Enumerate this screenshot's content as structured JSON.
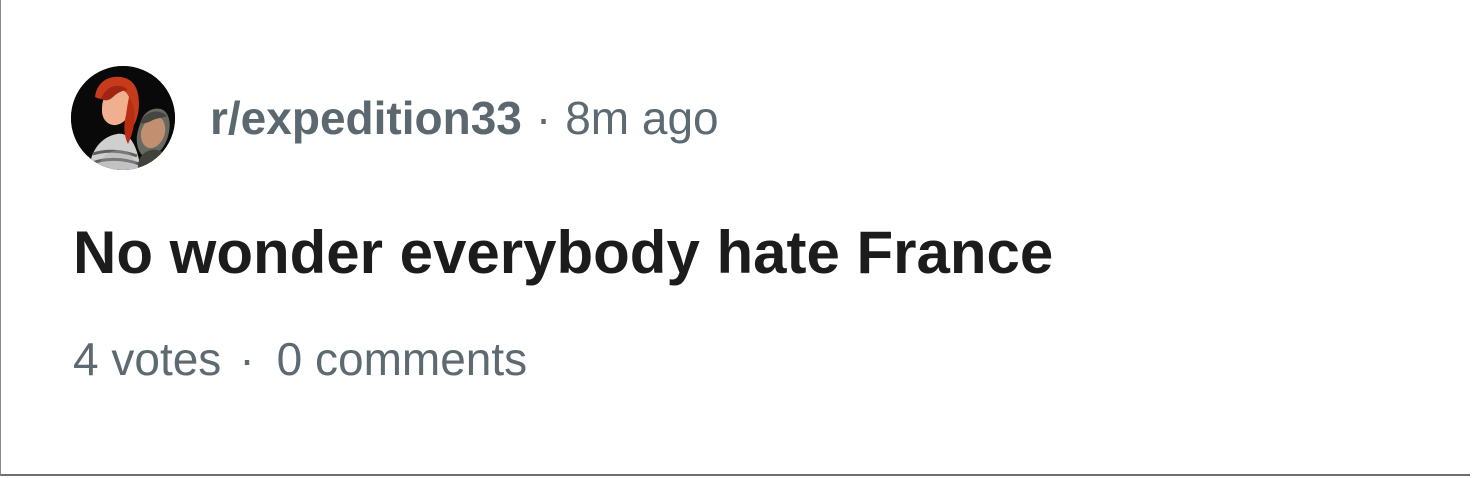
{
  "post": {
    "subreddit": "r/expedition33",
    "separator": "·",
    "time_ago": "8m ago",
    "title": "No wonder everybody hate France",
    "votes": "4 votes",
    "comments": "0 comments"
  },
  "avatar": {
    "icon": "subreddit-avatar-image"
  },
  "colors": {
    "background": "#ffffff",
    "title_text": "#1c1c1c",
    "meta_text": "#5d6a72"
  }
}
